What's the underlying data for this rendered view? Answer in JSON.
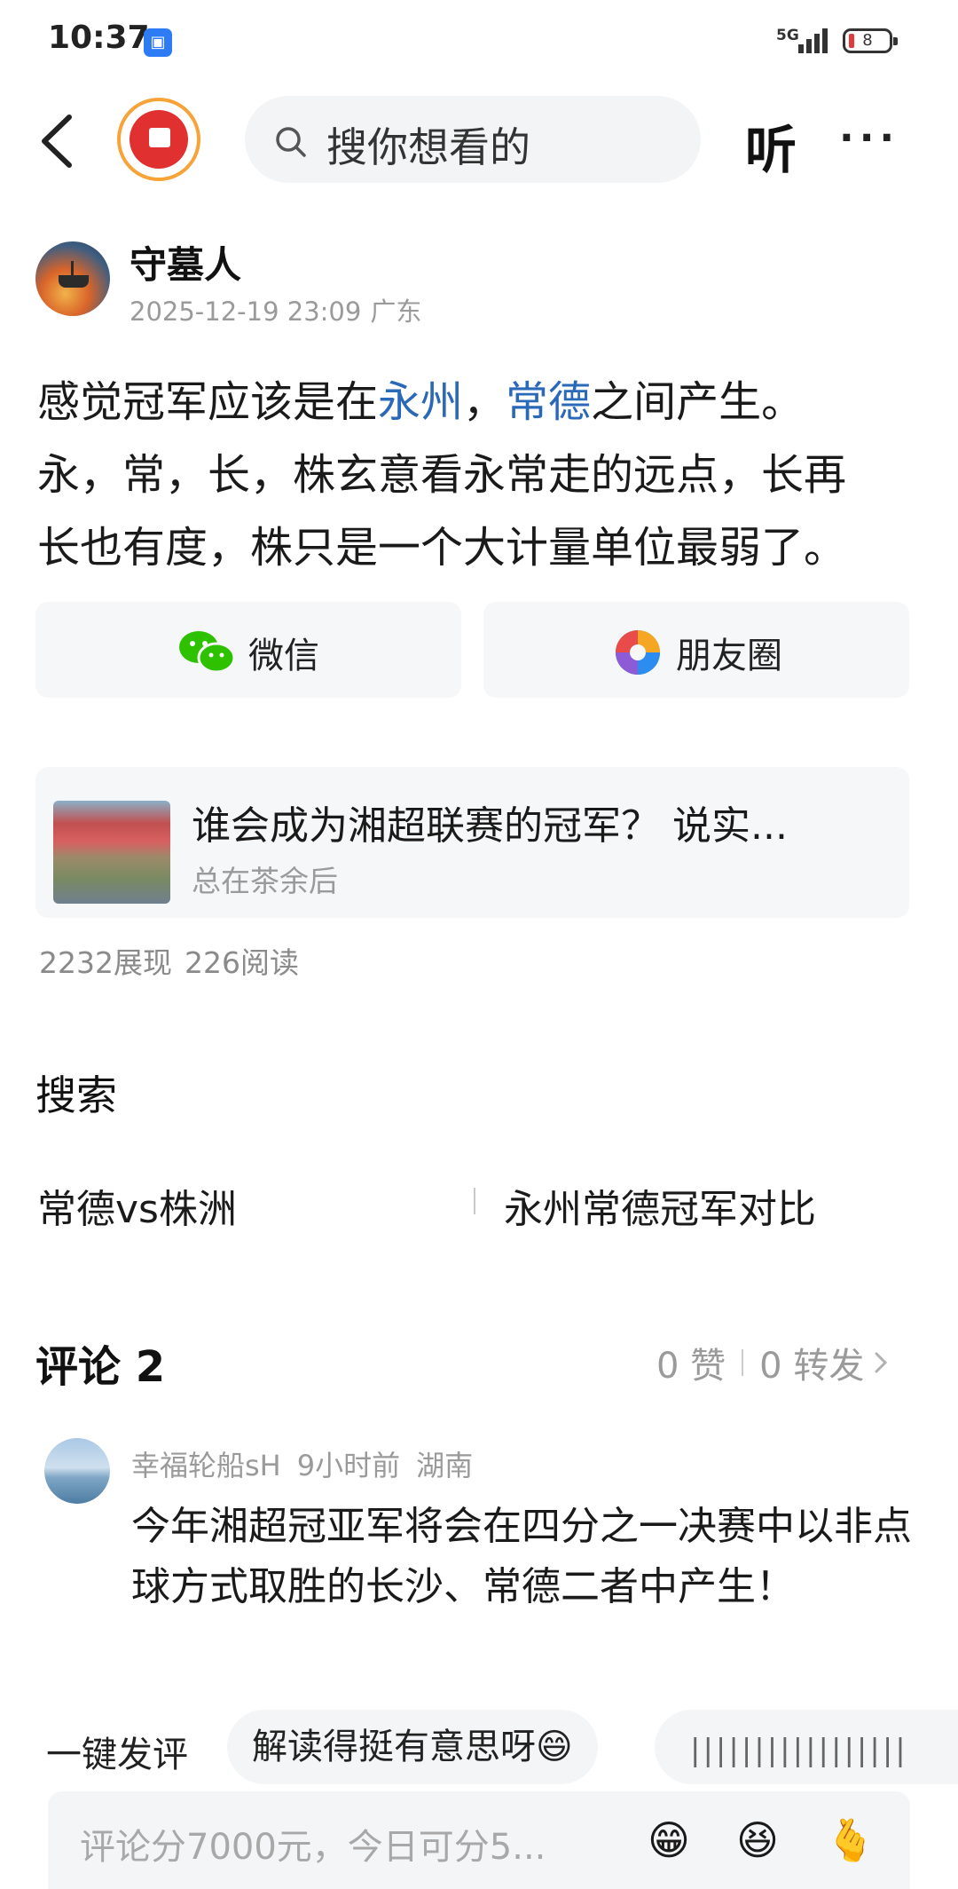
{
  "status_bar": {
    "time": "10:37",
    "network": "5G",
    "battery": "8"
  },
  "nav": {
    "search_placeholder": "搜你想看的",
    "listen_label": "听",
    "more_label": "···"
  },
  "author": {
    "name": "守墓人",
    "datetime": "2025-12-19 23:09",
    "location": "广东"
  },
  "post": {
    "line1_a": "感觉冠军应该是在",
    "line1_b": "永州",
    "line1_c": "，",
    "line1_d": "常德",
    "line1_e": "之间产生。",
    "line2": "永，常，长，株玄意看永常走的远点，长再",
    "line3": "长也有度，株只是一个大计量单位最弱了。"
  },
  "share": {
    "wechat_label": "微信",
    "moments_label": "朋友圈"
  },
  "article": {
    "title": "谁会成为湘超联赛的冠军？ 说实...",
    "source": "总在茶余后"
  },
  "stats": {
    "impressions": "2232展现",
    "reads": "226阅读"
  },
  "search_section": {
    "title": "搜索",
    "items": [
      "常德vs株洲",
      "永州常德冠军对比"
    ]
  },
  "comments": {
    "title": "评论 2",
    "likes": "0 赞",
    "forwards": "0 转发",
    "items": [
      {
        "user": "幸福轮船sH",
        "time": "9小时前",
        "location": "湖南",
        "text": "今年湘超冠亚军将会在四分之一决赛中以非点球方式取胜的长沙、常德二者中产生！"
      }
    ]
  },
  "quick_reply": {
    "label": "一键发评",
    "chips": [
      "解读得挺有意思呀😄"
    ]
  },
  "comment_input": {
    "placeholder": "评论分7000元，今日可分5...",
    "emojis": [
      "😁",
      "😆",
      "🫰"
    ]
  }
}
